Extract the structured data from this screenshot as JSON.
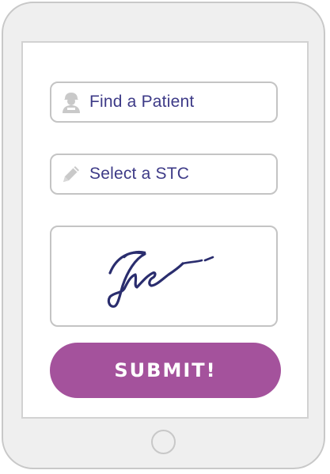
{
  "form": {
    "find_patient": {
      "label": "Find a Patient",
      "icon": "patient-icon"
    },
    "select_stc": {
      "label": "Select a STC",
      "icon": "pencil-icon"
    },
    "signature": {
      "icon": "signature-scribble"
    },
    "submit_label": "SUBMIT!"
  },
  "colors": {
    "accent": "#a4529c",
    "text": "#3d3a87",
    "border": "#c4c4c4",
    "device": "#efefef",
    "icon": "#c9c9c9",
    "ink": "#2a2d6e"
  }
}
